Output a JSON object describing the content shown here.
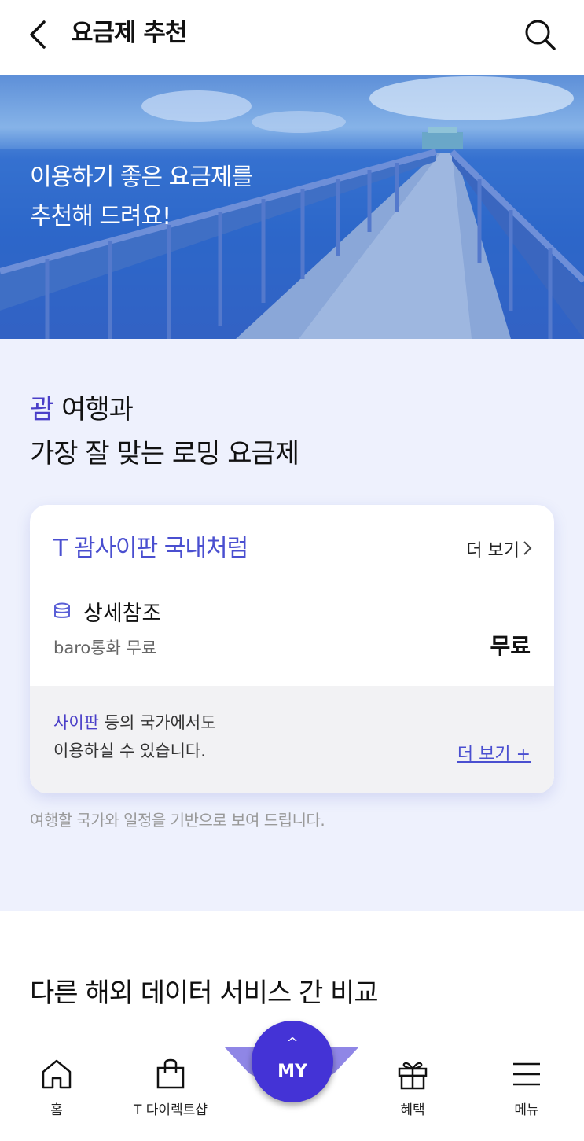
{
  "header": {
    "title": "요금제 추천"
  },
  "hero": {
    "line1": "이용하기 좋은 요금제를",
    "line2": "추천해 드려요!"
  },
  "recommend": {
    "heading_accent": "괌",
    "heading_rest": " 여행과",
    "heading_line2": "가장 잘 맞는 로밍 요금제",
    "card": {
      "plan_name": "T 괌사이판 국내처럼",
      "more_label": "더 보기",
      "detail_label": "상세참조",
      "sub_label": "baro통화 무료",
      "price": "무료",
      "foot_accent": "사이판",
      "foot_line1_rest": " 등의 국가에서도",
      "foot_line2": "이용하실 수 있습니다.",
      "foot_more": "더 보기 +"
    },
    "note": "여행할 국가와 일정을 기반으로 보여 드립니다."
  },
  "compare": {
    "title": "다른 해외 데이터 서비스 간 비교"
  },
  "bottom_nav": {
    "items": [
      {
        "label": "홈",
        "icon": "home-icon"
      },
      {
        "label": "T 다이렉트샵",
        "icon": "shopping-bag-icon"
      },
      {
        "label": "혜택",
        "icon": "gift-icon"
      },
      {
        "label": "메뉴",
        "icon": "hamburger-menu-icon"
      }
    ],
    "my_label": "MY",
    "my_caret": "^"
  },
  "colors": {
    "accent": "#4a3fc8",
    "section_bg": "#eef1fd",
    "my_button": "#4433d6"
  }
}
